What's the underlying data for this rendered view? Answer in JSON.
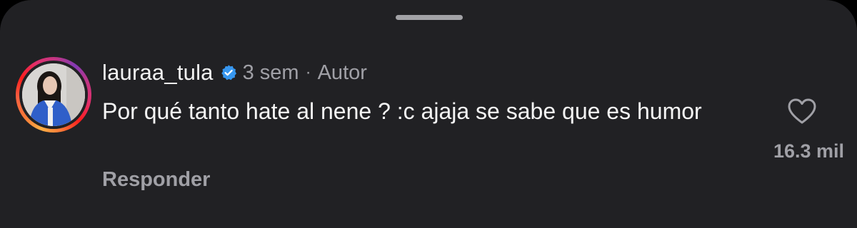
{
  "comment": {
    "username": "lauraa_tula",
    "time": "3 sem",
    "separator": "·",
    "author_label": "Autor",
    "text": "Por qué tanto hate al nene ? :c ajaja se sabe que es humor",
    "reply_label": "Responder",
    "like_count": "16.3 mil"
  },
  "icons": {
    "verified": "verified-badge-icon",
    "like": "heart-outline-icon"
  },
  "colors": {
    "sheet_background": "#212124",
    "verified_blue": "#3797f0",
    "secondary_text": "#a0a0a6"
  }
}
